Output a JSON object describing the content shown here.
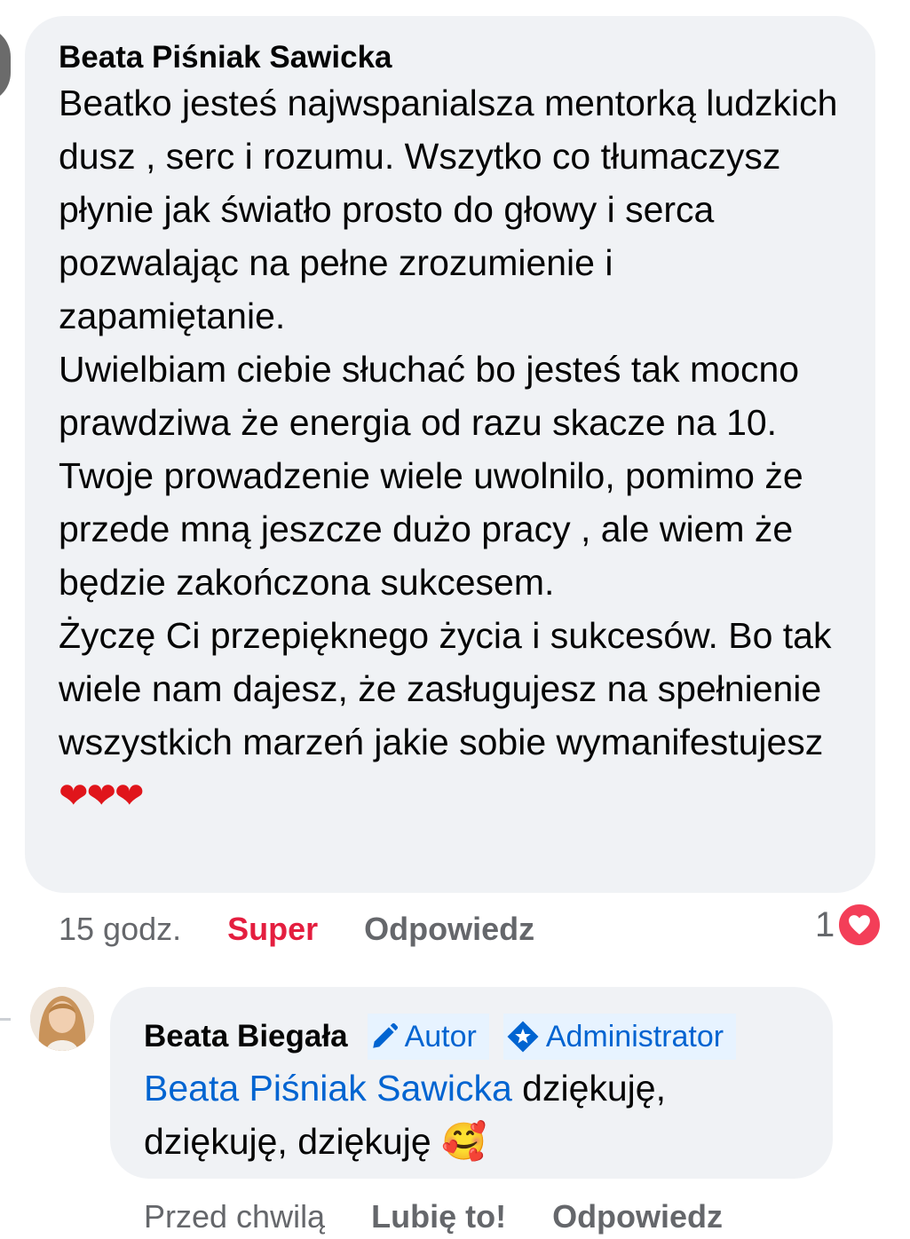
{
  "comment": {
    "author": "Beata Piśniak Sawicka",
    "text": "Beatko jesteś najwspanialsza mentorką ludzkich dusz , serc i rozumu. Wszytko co tłumaczysz płynie jak światło prosto do głowy i serca pozwalając na pełne zrozumienie i zapamiętanie.\nUwielbiam ciebie słuchać bo jesteś tak mocno prawdziwa że energia od razu skacze na 10. Twoje prowadzenie wiele uwolnilo, pomimo że przede mną jeszcze dużo pracy , ale wiem że będzie zakończona sukcesem.\nŻyczę Ci przepięknego życia i sukcesów. Bo tak wiele nam dajesz, że zasługujesz na spełnienie wszystkich marzeń jakie sobie wymanifestujesz",
    "hearts": "❤❤❤",
    "time": "15 godz.",
    "reaction_label": "Super",
    "reply_label": "Odpowiedz",
    "reaction_count": "1"
  },
  "reply": {
    "author": "Beata Biegała",
    "badge_author": "Autor",
    "badge_admin": "Administrator",
    "mention": "Beata Piśniak Sawicka",
    "text": " dziękuję, dziękuję, dziękuję ",
    "emoji": "🥰",
    "time": "Przed chwilą",
    "like_label": "Lubię to!",
    "reply_label": "Odpowiedz"
  },
  "colors": {
    "bubble_bg": "#f0f2f5",
    "link_blue": "#0064d1",
    "super_red": "#e41e3f",
    "love_pink": "#f33e58",
    "meta_gray": "#65676b"
  }
}
